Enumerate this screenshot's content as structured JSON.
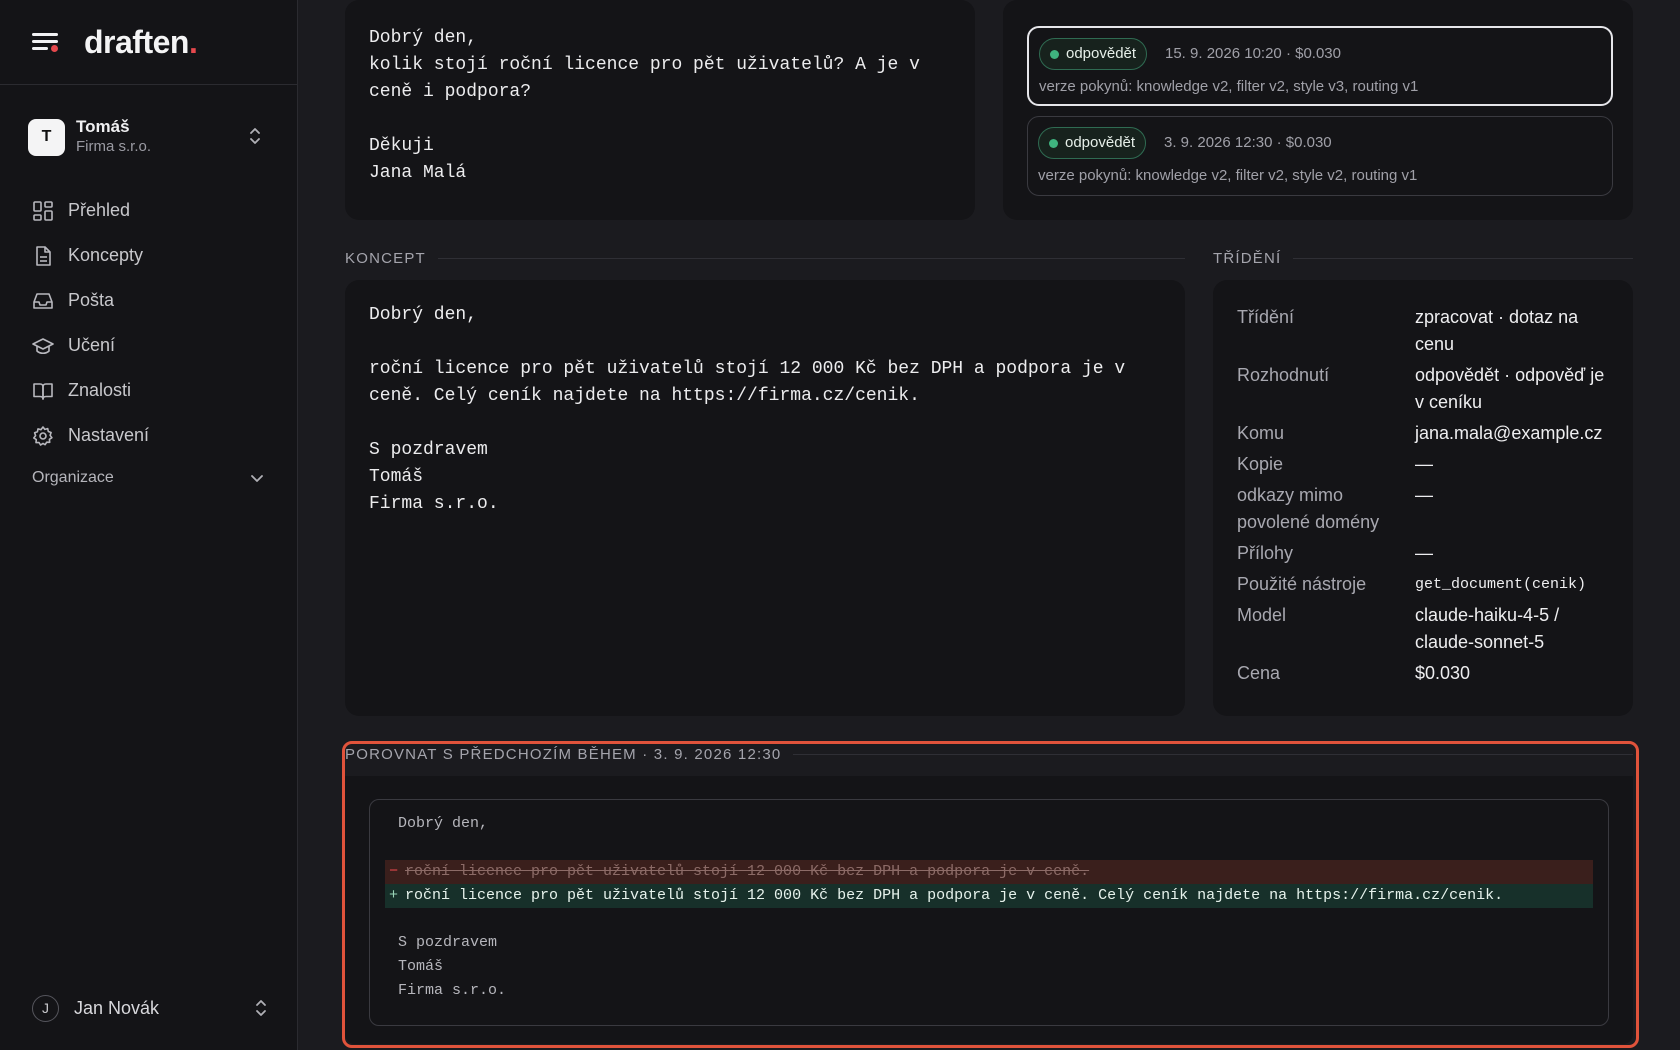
{
  "app": {
    "brand": "draften",
    "brand_dot": "."
  },
  "account": {
    "initial": "T",
    "name": "Tomáš",
    "org": "Firma s.r.o."
  },
  "nav": {
    "items": [
      {
        "label": "Přehled",
        "icon": "grid-icon"
      },
      {
        "label": "Koncepty",
        "icon": "document-icon"
      },
      {
        "label": "Pošta",
        "icon": "inbox-icon"
      },
      {
        "label": "Učení",
        "icon": "graduation-cap-icon"
      },
      {
        "label": "Znalosti",
        "icon": "book-icon"
      },
      {
        "label": "Nastavení",
        "icon": "gear-icon"
      }
    ],
    "organization": "Organizace"
  },
  "user": {
    "initial": "J",
    "name": "Jan Novák"
  },
  "email": {
    "body": "Dobrý den,\nkolik stojí roční licence pro pět uživatelů? A je v\nceně i podpora?\n\nDěkuji\nJana Malá"
  },
  "runs": [
    {
      "status": "odpovědět",
      "meta": "15. 9. 2026 10:20 · $0.030",
      "versions": "verze pokynů: knowledge v2, filter v2, style v3, routing v1",
      "active": true
    },
    {
      "status": "odpovědět",
      "meta": "3. 9. 2026 12:30 · $0.030",
      "versions": "verze pokynů: knowledge v2, filter v2, style v2, routing v1",
      "active": false
    }
  ],
  "draft": {
    "label": "KONCEPT",
    "body": "Dobrý den,\n\nroční licence pro pět uživatelů stojí 12 000 Kč bez DPH a podpora je v\nceně. Celý ceník najdete na https://firma.cz/cenik.\n\nS pozdravem\nTomáš\nFirma s.r.o."
  },
  "triage": {
    "label": "TŘÍDĚNÍ",
    "rows": [
      {
        "key": "Třídění",
        "value": "zpracovat · dotaz na cenu"
      },
      {
        "key": "Rozhodnutí",
        "value": "odpovědět · odpověď je v ceníku"
      },
      {
        "key": "Komu",
        "value": "jana.mala@example.cz"
      },
      {
        "key": "Kopie",
        "value": "—"
      },
      {
        "key": "odkazy mimo povolené domény",
        "value": "—"
      },
      {
        "key": "Přílohy",
        "value": "—"
      },
      {
        "key": "Použité nástroje",
        "value": "get_document(cenik)"
      },
      {
        "key": "Model",
        "value": "claude-haiku-4-5 / claude-sonnet-5"
      },
      {
        "key": "Cena",
        "value": "$0.030"
      }
    ]
  },
  "compare": {
    "label": "POROVNAT S PŘEDCHOZÍM BĚHEM · 3. 9. 2026 12:30",
    "lines": [
      {
        "type": "ctx",
        "text": "Dobrý den,"
      },
      {
        "type": "ctx",
        "text": ""
      },
      {
        "type": "del",
        "sign": "−",
        "text": "roční licence pro pět uživatelů stojí 12 000 Kč bez DPH a podpora je v ceně."
      },
      {
        "type": "add",
        "sign": "+",
        "text": "roční licence pro pět uživatelů stojí 12 000 Kč bez DPH a podpora je v ceně. Celý ceník najdete na https://firma.cz/cenik."
      },
      {
        "type": "ctx",
        "text": ""
      },
      {
        "type": "ctx",
        "text": "S pozdravem"
      },
      {
        "type": "ctx",
        "text": "Tomáš"
      },
      {
        "type": "ctx",
        "text": "Firma s.r.o."
      }
    ]
  },
  "colors": {
    "accent_red": "#e5484d",
    "status_green": "#3fb37f",
    "highlight_border": "#e0533b"
  }
}
